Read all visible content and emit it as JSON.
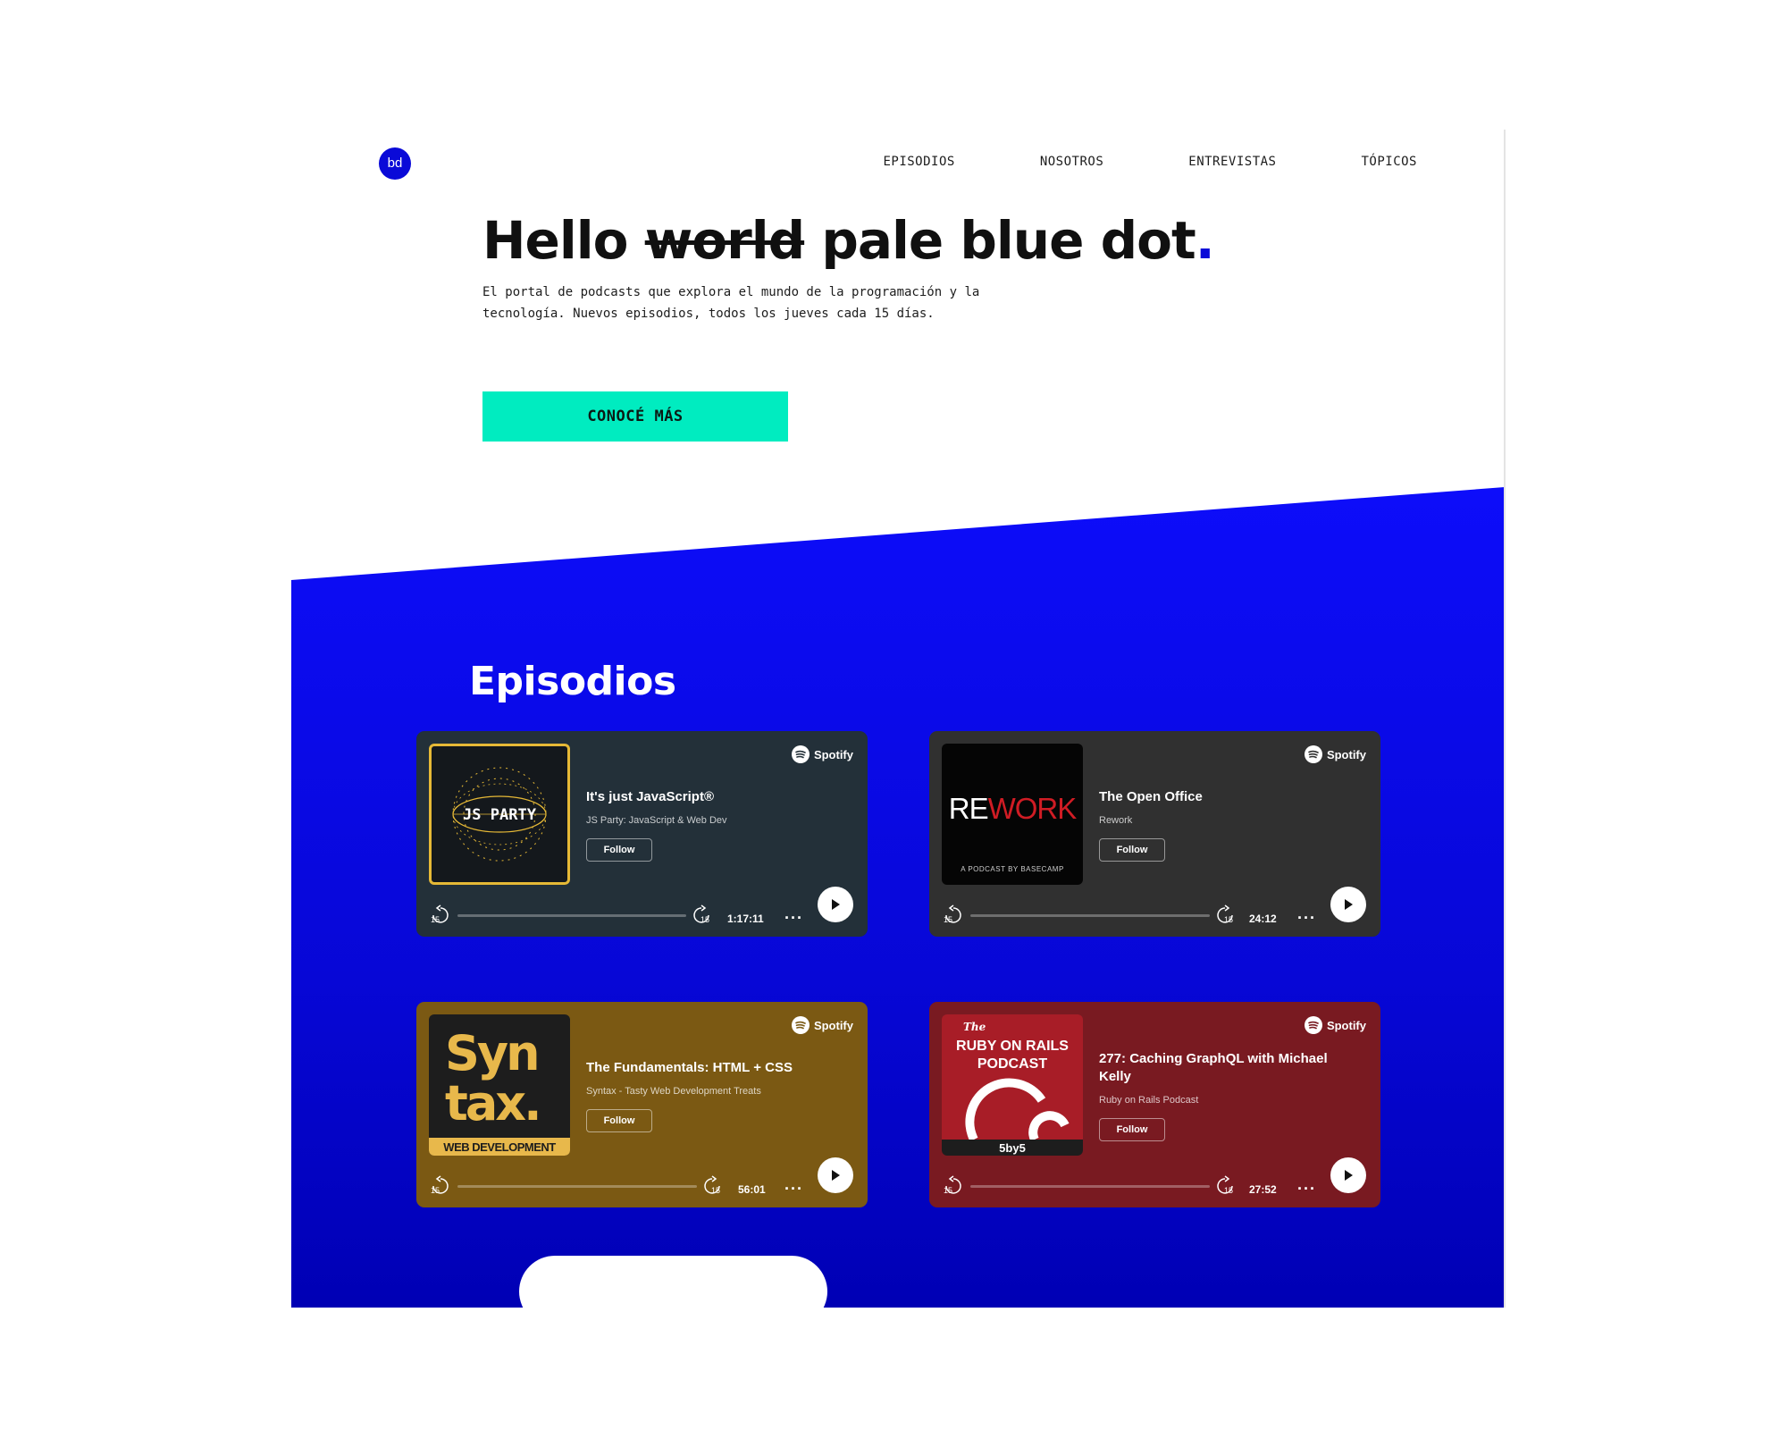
{
  "brand": {
    "logo_text": "bd",
    "accent": "#0a0ad8"
  },
  "nav": {
    "items": [
      {
        "label": "EPISODIOS"
      },
      {
        "label": "NOSOTROS"
      },
      {
        "label": "ENTREVISTAS"
      },
      {
        "label": "TÓPICOS"
      }
    ]
  },
  "hero": {
    "title_start": "Hello",
    "title_struck": "world",
    "title_end": "pale blue dot",
    "title_dot": ".",
    "subtitle": "El portal de podcasts que explora el mundo de la programación y la tecnología. Nuevos episodios, todos los jueves cada 15 días.",
    "cta_label": "CONOCÉ MÁS",
    "cta_color": "#00ecc0"
  },
  "episodes_section": {
    "title": "Episodios",
    "band_color": "#0a0af0",
    "cards": [
      {
        "provider": "Spotify",
        "title": "It's just JavaScript®",
        "show": "JS Party: JavaScript & Web Dev",
        "follow_label": "Follow",
        "duration": "1:17:11",
        "cover_text": "JS PARTY",
        "background": "#233039"
      },
      {
        "provider": "Spotify",
        "title": "The Open Office",
        "show": "Rework",
        "follow_label": "Follow",
        "duration": "24:12",
        "cover_text": "REWORK",
        "cover_caption": "A PODCAST BY BASECAMP",
        "background": "#303030"
      },
      {
        "provider": "Spotify",
        "title": "The Fundamentals: HTML + CSS",
        "show": "Syntax - Tasty Web Development Treats",
        "follow_label": "Follow",
        "duration": "56:01",
        "cover_text_1": "Syn",
        "cover_text_2": "tax.",
        "cover_caption": "WEB DEVELOPMENT",
        "background": "#7b5913"
      },
      {
        "provider": "Spotify",
        "title": "277: Caching GraphQL with Michael Kelly",
        "show": "Ruby on Rails Podcast",
        "follow_label": "Follow",
        "duration": "27:52",
        "cover_text_small": "The",
        "cover_text_1": "RUBY ON RAILS",
        "cover_text_2": "PODCAST",
        "cover_badge": "5by5",
        "background": "#791a21"
      }
    ]
  },
  "player": {
    "skip_seconds": "15"
  }
}
